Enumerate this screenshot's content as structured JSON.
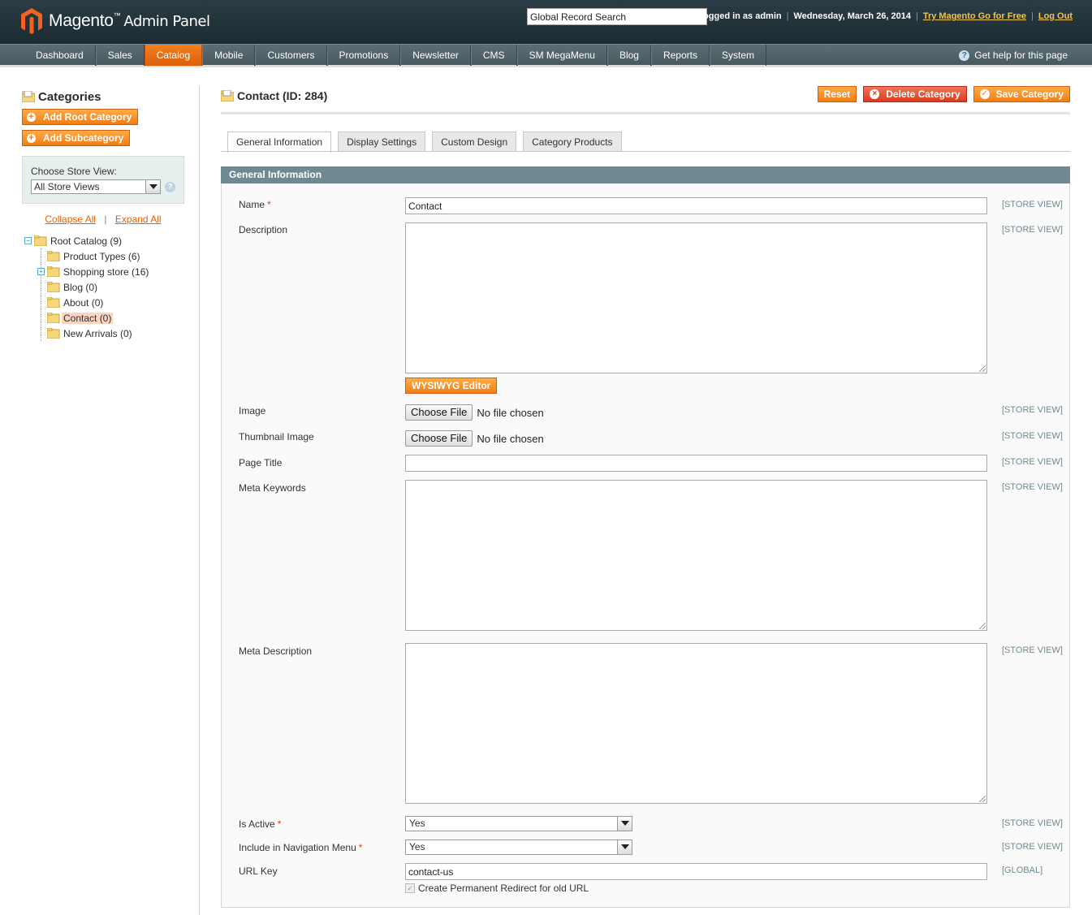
{
  "header": {
    "logo_brand": "Magento",
    "logo_tm": "™",
    "logo_panel": "Admin Panel",
    "search_value": "Global Record Search",
    "logged_in": "Logged in as admin",
    "date": "Wednesday, March 26, 2014",
    "try_link": "Try Magento Go for Free",
    "logout_link": "Log Out",
    "separator": "|"
  },
  "nav": {
    "items": [
      "Dashboard",
      "Sales",
      "Catalog",
      "Mobile",
      "Customers",
      "Promotions",
      "Newsletter",
      "CMS",
      "SM MegaMenu",
      "Blog",
      "Reports",
      "System"
    ],
    "active": "Catalog",
    "help": "Get help for this page",
    "help_icon": "?"
  },
  "sidebar": {
    "title": "Categories",
    "add_root": "Add Root Category",
    "add_sub": "Add Subcategory",
    "plus_glyph": "+",
    "store_label": "Choose Store View:",
    "store_value": "All Store Views",
    "store_help_icon": "?",
    "collapse_all": "Collapse All",
    "expand_all": "Expand All",
    "separator": "|",
    "tree": {
      "root": "Root Catalog (9)",
      "root_toggle": "−",
      "children": [
        {
          "label": "Product Types (6)",
          "toggle": ""
        },
        {
          "label": "Shopping store (16)",
          "toggle": "+"
        },
        {
          "label": "Blog (0)",
          "toggle": ""
        },
        {
          "label": "About (0)",
          "toggle": ""
        },
        {
          "label": "Contact (0)",
          "toggle": "",
          "selected": true
        },
        {
          "label": "New Arrivals (0)",
          "toggle": ""
        }
      ]
    }
  },
  "main": {
    "title": "Contact (ID: 284)",
    "buttons": {
      "reset": "Reset",
      "delete": "Delete Category",
      "save": "Save Category",
      "delete_glyph": "×",
      "save_glyph": "✓"
    },
    "tabs": [
      "General Information",
      "Display Settings",
      "Custom Design",
      "Category Products"
    ],
    "active_tab": "General Information",
    "section_title": "General Information",
    "fields": {
      "name_label": "Name",
      "name_value": "Contact",
      "description_label": "Description",
      "wysiwyg": "WYSIWYG Editor",
      "image_label": "Image",
      "thumbnail_label": "Thumbnail Image",
      "choose_file": "Choose File",
      "no_file": "No file chosen",
      "page_title_label": "Page Title",
      "page_title_value": "",
      "meta_keywords_label": "Meta Keywords",
      "meta_description_label": "Meta Description",
      "is_active_label": "Is Active",
      "is_active_value": "Yes",
      "include_nav_label": "Include in Navigation Menu",
      "include_nav_value": "Yes",
      "url_key_label": "URL Key",
      "url_key_value": "contact-us",
      "redirect_label": "Create Permanent Redirect for old URL",
      "redirect_checked": true,
      "check_glyph": "✓",
      "required_mark": "*"
    },
    "scopes": {
      "store_view": "[STORE VIEW]",
      "global": "[GLOBAL]"
    }
  },
  "colors": {
    "accent_orange": "#f07d14",
    "header_bg": "#1c2b31",
    "nav_bg": "#48585f",
    "section_head": "#6f8992",
    "selected_node": "#fbd5c0"
  }
}
